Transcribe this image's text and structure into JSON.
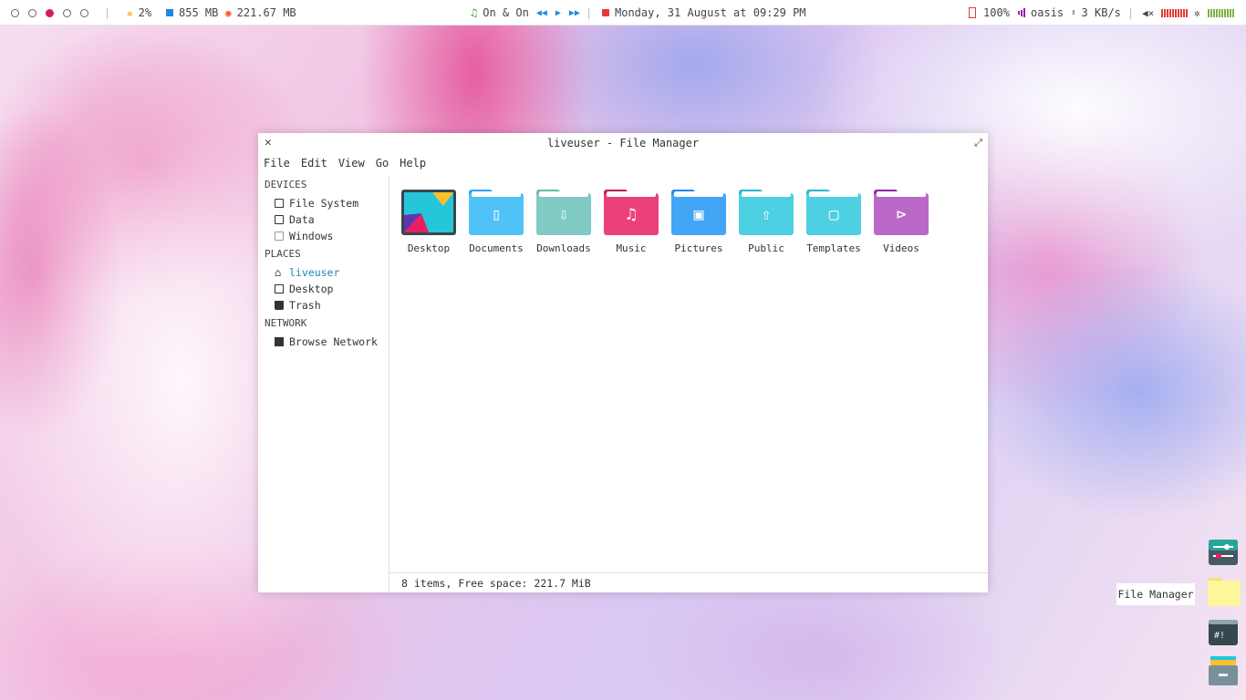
{
  "panel": {
    "cpu": "2%",
    "memory": "855 MB",
    "disk": "221.67 MB",
    "music_track": "On & On",
    "datetime": "Monday, 31 August at 09:29 PM",
    "battery": "100%",
    "network_name": "oasis",
    "network_speed": "3 KB/s",
    "accent": "#d81b60"
  },
  "window": {
    "title": "liveuser - File Manager",
    "menu": [
      "File",
      "Edit",
      "View",
      "Go",
      "Help"
    ],
    "sidebar": {
      "devices_header": "DEVICES",
      "devices": [
        "File System",
        "Data",
        "Windows"
      ],
      "places_header": "PLACES",
      "places": [
        "liveuser",
        "Desktop",
        "Trash"
      ],
      "network_header": "NETWORK",
      "network": [
        "Browse Network"
      ]
    },
    "files": [
      {
        "name": "Desktop",
        "icon": "desktop-folder-icon"
      },
      {
        "name": "Documents",
        "icon": "documents-folder-icon"
      },
      {
        "name": "Downloads",
        "icon": "downloads-folder-icon"
      },
      {
        "name": "Music",
        "icon": "music-folder-icon"
      },
      {
        "name": "Pictures",
        "icon": "pictures-folder-icon"
      },
      {
        "name": "Public",
        "icon": "public-folder-icon"
      },
      {
        "name": "Templates",
        "icon": "templates-folder-icon"
      },
      {
        "name": "Videos",
        "icon": "videos-folder-icon"
      }
    ],
    "status": "8 items, Free space: 221.7 MiB"
  },
  "dock": {
    "tooltip": "File Manager"
  }
}
